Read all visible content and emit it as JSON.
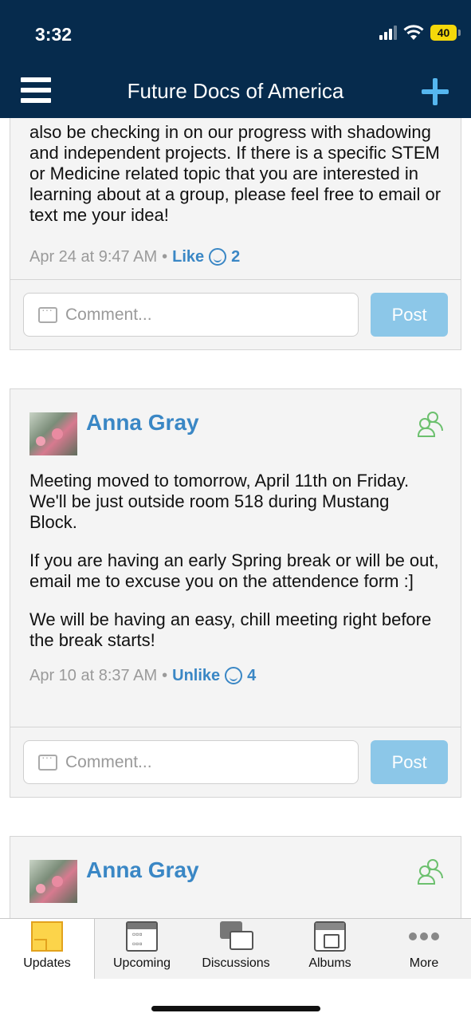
{
  "status_bar": {
    "time": "3:32",
    "battery": "40"
  },
  "nav": {
    "title": "Future Docs of America"
  },
  "posts": [
    {
      "text_lines": [
        "also be checking in on our progress with shadowing and independent projects. If there is a specific STEM or Medicine related topic that you are interested in learning about at a group, please feel free to email or text me your idea!"
      ],
      "timestamp": "Apr 24 at 9:47 AM",
      "like_label": "Like",
      "like_count": "2",
      "comment_placeholder": "Comment...",
      "post_label": "Post"
    },
    {
      "author": "Anna Gray",
      "paragraphs": [
        "Meeting moved to tomorrow, April 11th on Friday. We'll be just outside room 518 during Mustang Block.",
        "If you are having an early Spring break or will be out, email me to excuse you on the attendence form :]",
        "We will be having an easy, chill meeting right before the break starts!"
      ],
      "timestamp": "Apr 10 at 8:37 AM",
      "like_label": "Unlike",
      "like_count": "4",
      "comment_placeholder": "Comment...",
      "post_label": "Post"
    },
    {
      "author": "Anna Gray"
    }
  ],
  "tabs": [
    {
      "label": "Updates",
      "icon": "updates-icon",
      "active": true
    },
    {
      "label": "Upcoming",
      "icon": "calendar-icon"
    },
    {
      "label": "Discussions",
      "icon": "discussions-icon"
    },
    {
      "label": "Albums",
      "icon": "albums-icon"
    },
    {
      "label": "More",
      "icon": "more-icon"
    }
  ],
  "colors": {
    "nav_bg": "#062b4d",
    "link": "#3a87c5",
    "post_button": "#8cc7e8",
    "group_icon": "#6cc06e",
    "plus": "#55b6ef"
  }
}
